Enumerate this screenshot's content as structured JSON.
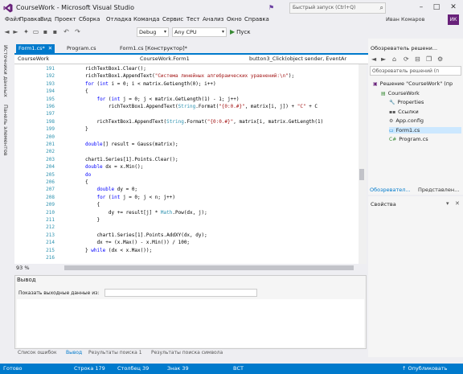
{
  "window": {
    "title": "CourseWork - Microsoft Visual Studio",
    "quick_launch_placeholder": "Быстрый запуск (Ctrl+Q)",
    "account_name": "Иван Комаров",
    "avatar_initials": "ИК"
  },
  "menu": [
    "Файл",
    "Правка",
    "Вид",
    "Проект",
    "Сборка",
    "Отладка",
    "Команда",
    "Сервис",
    "Тест",
    "Анализ",
    "Окно",
    "Справка"
  ],
  "toolbar": {
    "configuration": "Debug",
    "platform": "Any CPU",
    "start_label": "Пуск"
  },
  "left_vtabs": [
    "Источники данных",
    "Панель элементов"
  ],
  "doc_tabs": [
    {
      "label": "Form1.cs*",
      "active": true
    },
    {
      "label": "Program.cs",
      "active": false
    },
    {
      "label": "Form1.cs [Конструктор]*",
      "active": false
    }
  ],
  "navbar": {
    "project": "CourseWork",
    "class": "CourseWork.Form1",
    "member": "button3_Click(object sender, EventAr"
  },
  "code_lines": [
    {
      "n": "191",
      "text": "richTextBox1.Clear();"
    },
    {
      "n": "192",
      "text": "richTextBox1.AppendText(\"Система линейных алгебраических уравнений:\\n\");"
    },
    {
      "n": "193",
      "text": "for (int i = 0; i < matrix.GetLength(0); i++)"
    },
    {
      "n": "194",
      "text": "{"
    },
    {
      "n": "195",
      "text": "    for (int j = 0; j < matrix.GetLength(1) - 1; j++)"
    },
    {
      "n": "196",
      "text": "        richTextBox1.AppendText(String.Format(\"{0:0.#}\", matrix[i, j]) + \"C\" + C"
    },
    {
      "n": "197",
      "text": ""
    },
    {
      "n": "198",
      "text": "    richTextBox1.AppendText(String.Format(\"{0:0.#}\", matrix[i, matrix.GetLength(1)"
    },
    {
      "n": "199",
      "text": "}"
    },
    {
      "n": "200",
      "text": ""
    },
    {
      "n": "201",
      "text": "double[] result = Gauss(matrix);"
    },
    {
      "n": "202",
      "text": ""
    },
    {
      "n": "203",
      "text": "chart1.Series[1].Points.Clear();"
    },
    {
      "n": "204",
      "text": "double dx = x.Min();"
    },
    {
      "n": "205",
      "text": "do"
    },
    {
      "n": "206",
      "text": "{"
    },
    {
      "n": "207",
      "text": "    double dy = 0;"
    },
    {
      "n": "208",
      "text": "    for (int j = 0; j < n; j++)"
    },
    {
      "n": "209",
      "text": "    {"
    },
    {
      "n": "210",
      "text": "        dy += result[j] * Math.Pow(dx, j);"
    },
    {
      "n": "211",
      "text": "    }"
    },
    {
      "n": "212",
      "text": ""
    },
    {
      "n": "213",
      "text": "    chart1.Series[1].Points.AddXY(dx, dy);"
    },
    {
      "n": "214",
      "text": "    dx += (x.Max() - x.Min()) / 100;"
    },
    {
      "n": "215",
      "text": "} while (dx < x.Max());"
    },
    {
      "n": "216",
      "text": ""
    }
  ],
  "editor": {
    "zoom": "93 %"
  },
  "output": {
    "title": "Вывод",
    "source_label": "Показать выходные данные из:",
    "source_value": ""
  },
  "bottom_tabs": [
    "Список ошибок",
    "Вывод",
    "Результаты поиска 1",
    "Результаты поиска символа"
  ],
  "solution_explorer": {
    "title": "Обозреватель решени...",
    "search_placeholder": "Обозреватель решений (п",
    "items": [
      {
        "label": "Решение \"CourseWork\" (пр",
        "level": 0,
        "icon": "solution-icon"
      },
      {
        "label": "CourseWork",
        "level": 1,
        "icon": "csharp-project-icon"
      },
      {
        "label": "Properties",
        "level": 2,
        "icon": "wrench-icon"
      },
      {
        "label": "Ссылки",
        "level": 2,
        "icon": "references-icon"
      },
      {
        "label": "App.config",
        "level": 2,
        "icon": "config-icon"
      },
      {
        "label": "Form1.cs",
        "level": 2,
        "icon": "form-icon"
      },
      {
        "label": "Program.cs",
        "level": 2,
        "icon": "csharp-file-icon"
      }
    ],
    "tabs": [
      "Обозревател...",
      "Представлен..."
    ]
  },
  "properties": {
    "title": "Свойства"
  },
  "status": {
    "ready": "Готово",
    "line": "Строка 179",
    "column": "Столбец 39",
    "char": "Знак 39",
    "mode": "ВСТ",
    "publish": "↑ Опубликовать"
  },
  "colors": {
    "accent": "#007acc",
    "keyword": "#0000ff",
    "string": "#a31515",
    "type": "#2b91af",
    "vs_purple": "#68217a"
  }
}
